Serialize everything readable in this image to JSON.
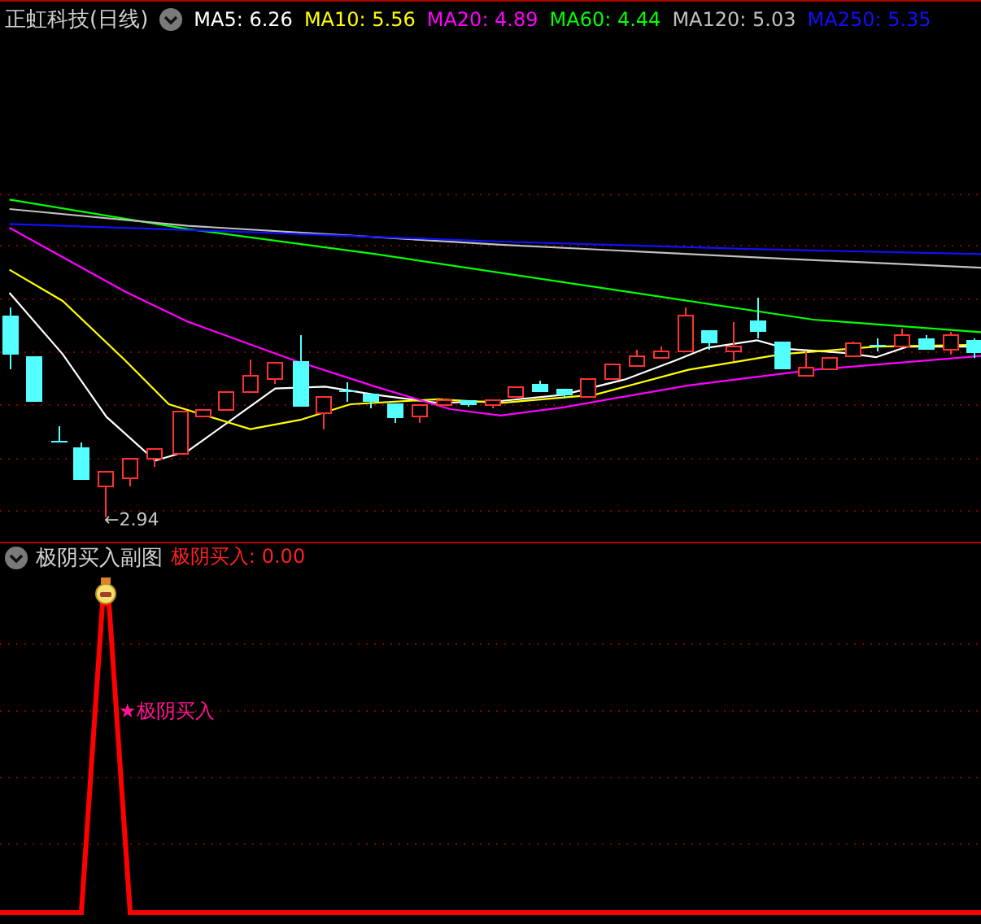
{
  "main_chart": {
    "title": "正虹科技(日线)",
    "moving_averages": [
      {
        "text": "MA5: 6.26",
        "color": "#ffffff"
      },
      {
        "text": "MA10: 5.56",
        "color": "#ffff00"
      },
      {
        "text": "MA20: 4.89",
        "color": "#ff00ff"
      },
      {
        "text": "MA60: 4.44",
        "color": "#00ff00"
      },
      {
        "text": "MA120: 5.03",
        "color": "#c0c0c0"
      },
      {
        "text": "MA250: 5.35",
        "color": "#1010ff"
      }
    ],
    "low_price_label": "←2.94"
  },
  "sub_chart": {
    "title": "极阴买入副图",
    "indicator": "极阴买入: 0.00",
    "signal_label": "★极阴买入"
  }
}
